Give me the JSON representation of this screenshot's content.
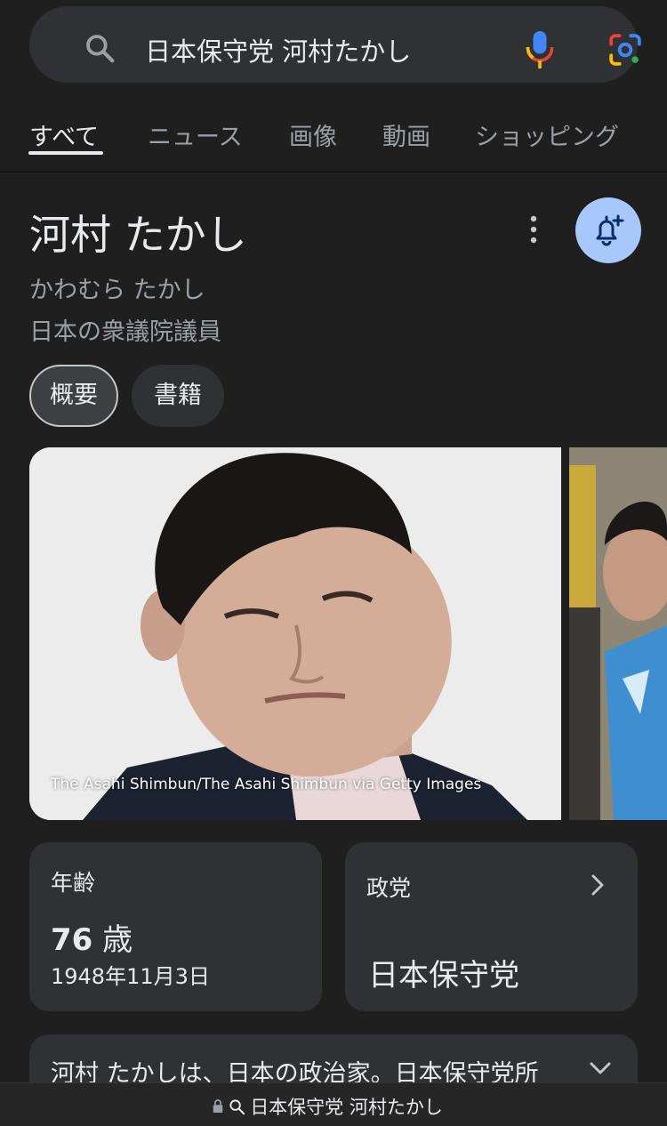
{
  "search": {
    "query": "日本保守党 河村たかし"
  },
  "tabs": [
    {
      "label": "すべて",
      "active": true
    },
    {
      "label": "ニュース"
    },
    {
      "label": "画像"
    },
    {
      "label": "動画"
    },
    {
      "label": "ショッピング"
    }
  ],
  "entity": {
    "title": "河村 たかし",
    "reading": "かわむら たかし",
    "description": "日本の衆議院議員"
  },
  "chips": [
    {
      "label": "概要",
      "selected": true
    },
    {
      "label": "書籍"
    }
  ],
  "photos": {
    "credit": "The Asahi Shimbun/The Asahi Shimbun via Getty Images"
  },
  "facts": {
    "age_label": "年齢",
    "age_number": "76",
    "age_unit": "歳",
    "birth_date": "1948年11月3日",
    "party_label": "政党",
    "party_value": "日本保守党"
  },
  "summary": {
    "text": "河村 たかしは、日本の政治家。日本保守党所"
  },
  "urlbar": {
    "text": "日本保守党 河村たかし"
  },
  "colors": {
    "background": "#1f1f1f",
    "surface": "#303134",
    "follow_button": "#a8c7fa"
  }
}
